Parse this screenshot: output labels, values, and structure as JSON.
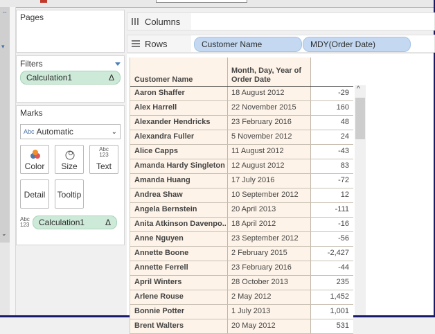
{
  "pages": {
    "title": "Pages"
  },
  "filters": {
    "title": "Filters",
    "pill": {
      "label": "Calculation1",
      "delta": "Δ"
    }
  },
  "marks": {
    "title": "Marks",
    "type_select": {
      "prefix": "Abc",
      "value": "Automatic"
    },
    "buttons": {
      "color": "Color",
      "size": "Size",
      "text": "Text",
      "text_icon": "Abc\n123",
      "detail": "Detail",
      "tooltip": "Tooltip"
    },
    "calc_pill": {
      "prefix": "Abc\n123",
      "label": "Calculation1",
      "delta": "Δ"
    }
  },
  "shelves": {
    "columns": "Columns",
    "rows": "Rows",
    "row_pills": [
      "Customer Name",
      "MDY(Order Date)"
    ]
  },
  "table": {
    "headers": [
      "Customer Name",
      "Month, Day, Year of Order Date",
      ""
    ],
    "rows": [
      [
        "Aaron Shaffer",
        "18 August 2012",
        "-29"
      ],
      [
        "Alex Harrell",
        "22 November 2015",
        "160"
      ],
      [
        "Alexander Hendricks",
        "23 February 2016",
        "48"
      ],
      [
        "Alexandra Fuller",
        "5 November 2012",
        "24"
      ],
      [
        "Alice Capps",
        "11 August 2012",
        "-43"
      ],
      [
        "Amanda Hardy Singleton",
        "12 August 2012",
        "83"
      ],
      [
        "Amanda Huang",
        "17 July 2016",
        "-72"
      ],
      [
        "Andrea Shaw",
        "10 September 2012",
        "12"
      ],
      [
        "Angela Bernstein",
        "20 April 2013",
        "-111"
      ],
      [
        "Anita Atkinson Davenpo..",
        "18 April 2012",
        "-16"
      ],
      [
        "Anne Nguyen",
        "23 September 2012",
        "-56"
      ],
      [
        "Annette Boone",
        "2 February 2015",
        "-2,427"
      ],
      [
        "Annette Ferrell",
        "23 February 2016",
        "-44"
      ],
      [
        "April Winters",
        "28 October 2013",
        "235"
      ],
      [
        "Arlene Rouse",
        "2 May 2012",
        "1,452"
      ],
      [
        "Bonnie Potter",
        "1 July 2013",
        "1,001"
      ],
      [
        "Brent Walters",
        "20 May 2012",
        "531"
      ]
    ]
  },
  "colors": {
    "green_pill": "#cde9d8",
    "blue_pill": "#c4d9f1",
    "table_bg": "#fdf3e8"
  }
}
